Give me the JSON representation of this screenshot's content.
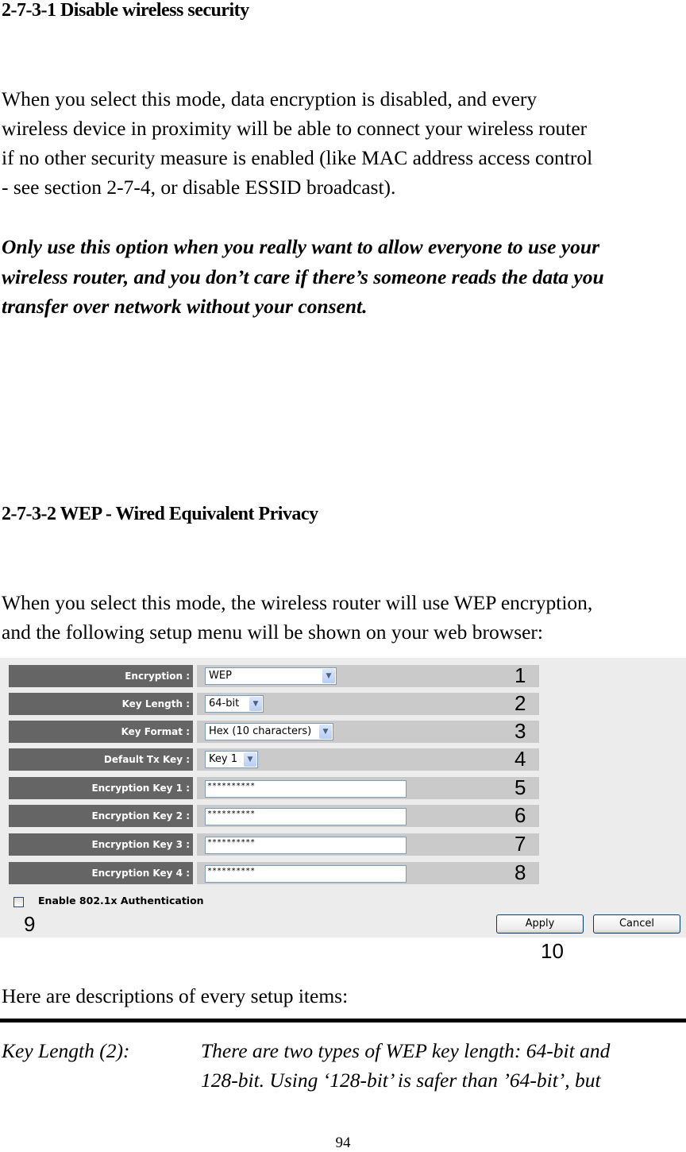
{
  "section1": {
    "heading": "2-7-3-1 Disable wireless security",
    "paragraph_lines": [
      "When you select this mode, data encryption is disabled, and every",
      "wireless device in proximity will be able to connect your wireless router",
      "if no other security measure is enabled (like MAC address access control",
      "- see section 2-7-4, or disable ESSID broadcast)."
    ],
    "warning_lines": [
      "Only use this option when you really want to allow everyone to use your",
      "wireless router, and you don’t care if there’s someone reads the data you",
      "transfer over network without your consent."
    ]
  },
  "section2": {
    "heading": "2-7-3-2 WEP - Wired Equivalent Privacy",
    "paragraph_lines": [
      "When you select this mode, the wireless router will use WEP encryption,",
      "and the following setup menu will be shown on your web browser:"
    ]
  },
  "screenshot": {
    "rows": [
      {
        "label": "Encryption :",
        "type": "select",
        "value": "WEP",
        "callout": "1"
      },
      {
        "label": "Key Length :",
        "type": "select",
        "value": "64-bit",
        "callout": "2"
      },
      {
        "label": "Key Format :",
        "type": "select",
        "value": "Hex (10 characters)",
        "callout": "3"
      },
      {
        "label": "Default Tx Key :",
        "type": "select",
        "value": "Key 1",
        "callout": "4"
      },
      {
        "label": "Encryption Key 1 :",
        "type": "password",
        "value": "**********",
        "callout": "5"
      },
      {
        "label": "Encryption Key 2 :",
        "type": "password",
        "value": "**********",
        "callout": "6"
      },
      {
        "label": "Encryption Key 3 :",
        "type": "password",
        "value": "**********",
        "callout": "7"
      },
      {
        "label": "Encryption Key 4 :",
        "type": "password",
        "value": "**********",
        "callout": "8"
      }
    ],
    "checkbox": {
      "label": "Enable 802.1x Authentication",
      "checked": false,
      "callout": "9"
    },
    "apply_label": "Apply",
    "cancel_label": "Cancel",
    "buttons_callout": "10",
    "dropdown_arrow_icon": "chevron-down-icon"
  },
  "descriptions_intro": "Here are descriptions of every setup items:",
  "description_items": [
    {
      "term": "Key Length (2):",
      "lines": [
        "There are two types of WEP key length: 64-bit and",
        "128-bit. Using ‘128-bit’ is safer than ’64-bit’, but"
      ]
    }
  ],
  "page_number": "94"
}
